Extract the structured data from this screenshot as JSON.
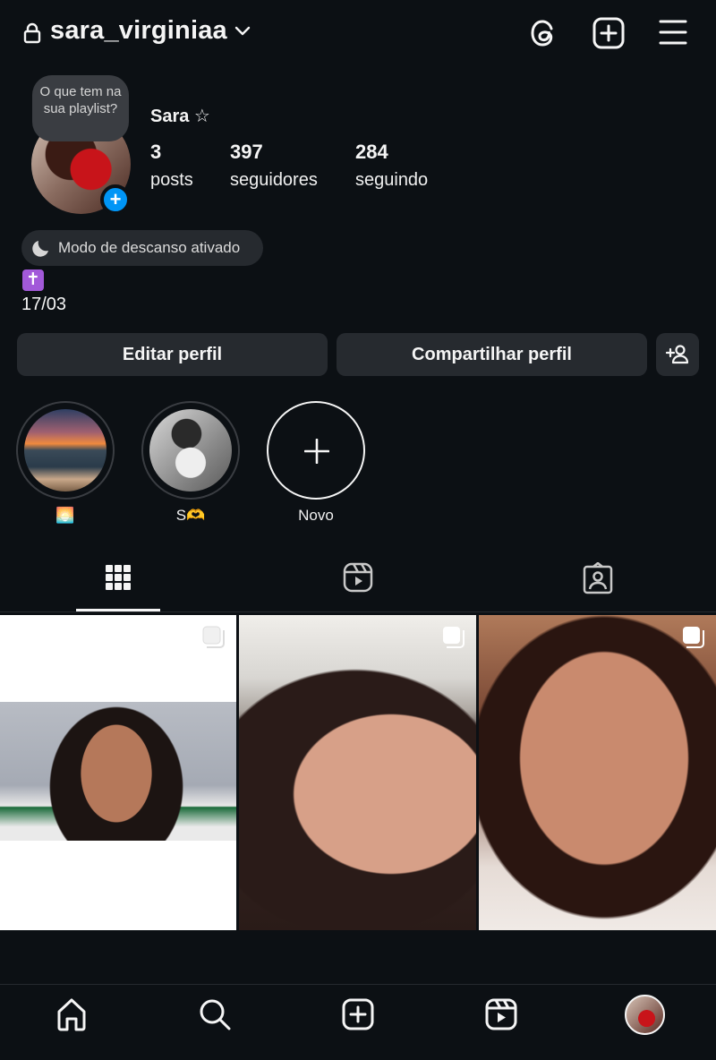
{
  "header": {
    "username": "sara_virginiaa",
    "icons": [
      "lock-icon",
      "chevron-down-icon",
      "threads-icon",
      "add-content-icon",
      "menu-icon"
    ]
  },
  "profile": {
    "note": "O que tem na sua playlist?",
    "display_name": "Sara ☆",
    "stats": {
      "posts_count": "3",
      "posts_label": "posts",
      "followers_count": "397",
      "followers_label": "seguidores",
      "following_count": "284",
      "following_label": "seguindo"
    },
    "rest_mode": "Modo de descanso ativado",
    "bio": {
      "emoji": "✝",
      "line": "17/03"
    }
  },
  "actions": {
    "edit_label": "Editar perfil",
    "share_label": "Compartilhar perfil"
  },
  "highlights": [
    {
      "label": "🌅"
    },
    {
      "label": "S🫶"
    },
    {
      "label": "Novo"
    }
  ],
  "tabs": [
    "grid",
    "reels",
    "tagged"
  ],
  "posts_count_visible": 3,
  "colors": {
    "background": "#0c1014",
    "surface": "#262a2f",
    "accent": "#0095f6",
    "text": "#f5f5f5"
  }
}
